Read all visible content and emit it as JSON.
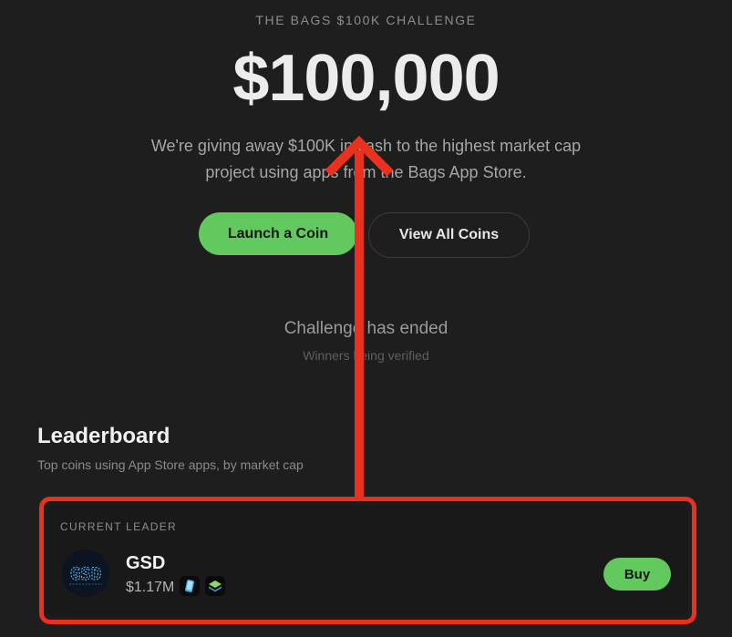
{
  "hero": {
    "eyebrow": "THE BAGS $100K CHALLENGE",
    "amount": "$100,000",
    "description": "We're giving away $100K in cash to the highest market cap project using apps from the Bags App Store."
  },
  "actions": {
    "launch_label": "Launch a Coin",
    "view_label": "View All Coins"
  },
  "status": {
    "title": "Challenge has ended",
    "subtitle": "Winners being verified"
  },
  "leaderboard": {
    "title": "Leaderboard",
    "subtitle": "Top coins using App Store apps, by market cap",
    "current_leader_label": "CURRENT LEADER",
    "leader": {
      "ticker": "GSD",
      "logo_text": "GSD",
      "market_cap": "$1.17M",
      "buy_label": "Buy",
      "app_icons": [
        "phone-app-icon",
        "layers-app-icon"
      ]
    }
  },
  "colors": {
    "background": "#1e1e1e",
    "accent_green": "#62c95e",
    "annotation_red": "#e8311f"
  }
}
